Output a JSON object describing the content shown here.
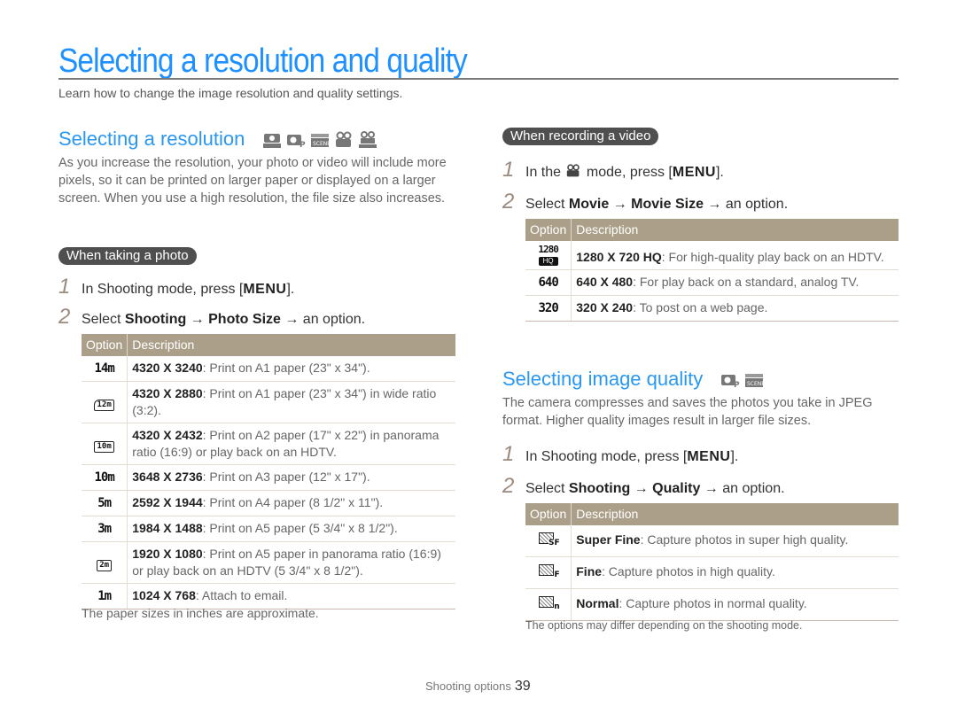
{
  "header": {
    "title": "Selecting a resolution and quality",
    "subtitle": "Learn how to change the image resolution and quality settings."
  },
  "colors": {
    "accent": "#1e90ff",
    "table_header": "#ab9f89",
    "pill": "#4f4f4f",
    "step_number": "#9b8a7e"
  },
  "resolution": {
    "heading": "Selecting a resolution",
    "mode_icons": [
      "smart-auto-icon",
      "program-icon",
      "scene-icon",
      "movie-icon",
      "smart-movie-icon"
    ],
    "intro": "As you increase the resolution, your photo or video will include more pixels, so it can be printed on larger paper or displayed on a larger screen. When you use a high resolution, the file size also increases.",
    "photo": {
      "pill": "When taking a photo",
      "step1_num": "1",
      "step1_pre": "In Shooting mode, press [",
      "step1_key": "MENU",
      "step1_post": "].",
      "step2_num": "2",
      "step2_pre": "Select ",
      "step2_b1": "Shooting",
      "step2_arrow1": " → ",
      "step2_b2": "Photo Size",
      "step2_post": " → an option.",
      "col_option": "Option",
      "col_description": "Description",
      "rows": [
        {
          "icon": "14m",
          "icon_name": "14m-icon",
          "value": "4320 X 3240",
          "desc": ": Print on A1 paper (23\" x 34\")."
        },
        {
          "icon": "12m",
          "icon_name": "12m-wide-icon",
          "value": "4320 X 2880",
          "desc": ": Print on A1 paper (23\" x 34\") in wide ratio (3:2)."
        },
        {
          "icon": "10m",
          "icon_name": "10m-panorama-icon",
          "value": "4320 X 2432",
          "desc": ": Print on A2 paper (17\" x 22\") in panorama ratio (16:9) or play back on an HDTV."
        },
        {
          "icon": "10m",
          "icon_name": "10m-icon",
          "value": "3648 X 2736",
          "desc": ": Print on A3 paper (12\" x 17\")."
        },
        {
          "icon": "5m",
          "icon_name": "5m-icon",
          "value": "2592 X 1944",
          "desc": ": Print on A4 paper (8 1/2\" x 11\")."
        },
        {
          "icon": "3m",
          "icon_name": "3m-icon",
          "value": "1984 X 1488",
          "desc": ": Print on A5 paper (5 3/4\" x 8 1/2\")."
        },
        {
          "icon": "2m",
          "icon_name": "2m-panorama-icon",
          "value": "1920 X 1080",
          "desc": ": Print on A5 paper in panorama ratio (16:9) or play back on an HDTV (5 3/4\" x 8 1/2\")."
        },
        {
          "icon": "1m",
          "icon_name": "1m-icon",
          "value": "1024 X 768",
          "desc": ": Attach to email."
        }
      ],
      "note": "The paper sizes in inches are approximate."
    },
    "video": {
      "pill": "When recording a video",
      "step1_num": "1",
      "step1_pre": "In the ",
      "step1_mid": " mode, press [",
      "step1_key": "MENU",
      "step1_post": "].",
      "step2_num": "2",
      "step2_pre": "Select ",
      "step2_b1": "Movie",
      "step2_arrow1": " → ",
      "step2_b2": "Movie Size",
      "step2_post": " → an option.",
      "col_option": "Option",
      "col_description": "Description",
      "rows": [
        {
          "icon": "1280",
          "icon_sub": "HQ",
          "icon_name": "1280-hq-icon",
          "value": "1280 X 720 HQ",
          "desc": ": For high-quality play back on an HDTV."
        },
        {
          "icon": "640",
          "icon_name": "640-icon",
          "value": "640 X 480",
          "desc": ": For play back on a standard, analog TV."
        },
        {
          "icon": "320",
          "icon_name": "320-icon",
          "value": "320 X 240",
          "desc": ": To post on a web page."
        }
      ]
    }
  },
  "quality": {
    "heading": "Selecting image quality",
    "mode_icons": [
      "program-icon",
      "scene-icon"
    ],
    "intro": "The camera compresses and saves the photos you take in JPEG format. Higher quality images result in larger file sizes.",
    "step1_num": "1",
    "step1_pre": "In Shooting mode, press [",
    "step1_key": "MENU",
    "step1_post": "].",
    "step2_num": "2",
    "step2_pre": "Select ",
    "step2_b1": "Shooting",
    "step2_arrow1": " → ",
    "step2_b2": "Quality",
    "step2_post": " → an option.",
    "col_option": "Option",
    "col_description": "Description",
    "rows": [
      {
        "tag": "SF",
        "icon_name": "super-fine-icon",
        "value": "Super Fine",
        "desc": ": Capture photos in super high quality."
      },
      {
        "tag": "F",
        "icon_name": "fine-icon",
        "value": "Fine",
        "desc": ": Capture photos in high quality."
      },
      {
        "tag": "n",
        "icon_name": "normal-icon",
        "value": "Normal",
        "desc": ": Capture photos in normal quality."
      }
    ],
    "note": "The options may differ depending on the shooting mode."
  },
  "footer": {
    "section": "Shooting options",
    "page": "39"
  }
}
